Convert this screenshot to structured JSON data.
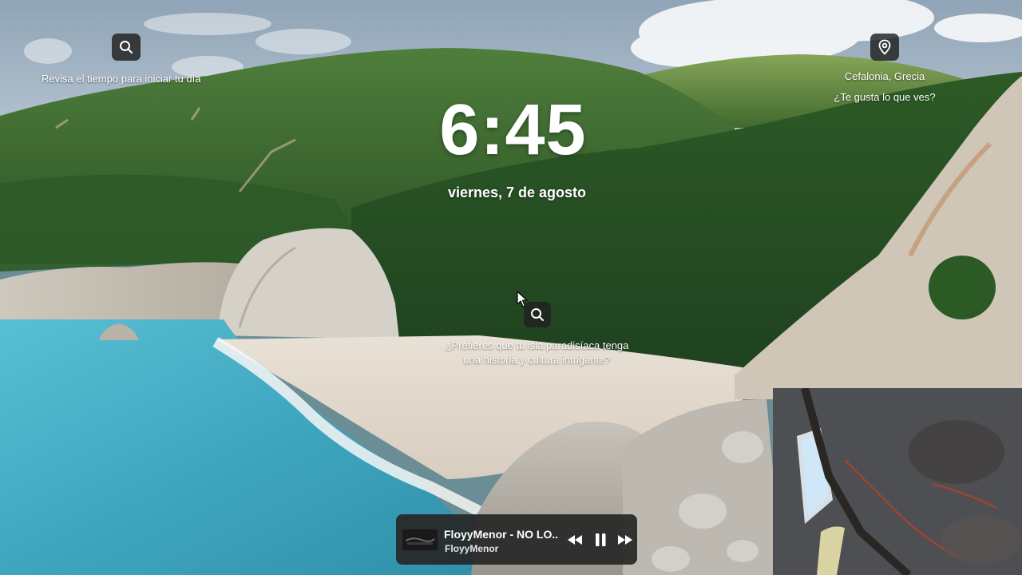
{
  "lockscreen": {
    "weather_prompt": "Revisa el tiempo para iniciar tu día",
    "location_name": "Cefalonia, Grecia",
    "like_prompt": "¿Te gusta lo que ves?",
    "time": "6:45",
    "date": "viernes, 7 de agosto",
    "spotlight_question_line1": "¿Prefieres que tu isla paradisíaca tenga",
    "spotlight_question_line2": "una historia y cultura intrigante?"
  },
  "media": {
    "title": "FloyyMenor - NO LO...",
    "artist": "FloyyMenor",
    "previous_icon": "rewind-icon",
    "play_pause_icon": "pause-icon",
    "next_icon": "fast-forward-icon"
  },
  "icons": {
    "weather": "search-icon",
    "location": "location-pin-icon",
    "spotlight": "search-icon"
  },
  "colors": {
    "panel_bg": "#262626",
    "text": "#ffffff",
    "sea": "#3fa9c4",
    "sand": "#e5ddd3",
    "forest": "#2f5a28"
  }
}
